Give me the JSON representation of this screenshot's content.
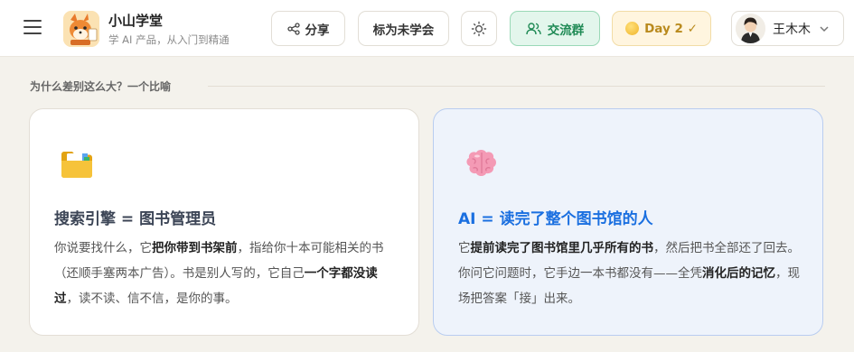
{
  "header": {
    "brand": {
      "name": "小山学堂",
      "subtitle": "学 AI 产品，从入门到精通"
    },
    "share_label": "分享",
    "mark_label": "标为未学会",
    "group_label": "交流群",
    "day_label": "Day 2 ✓",
    "user_name": "王木木",
    "colors": {
      "group_accent": "#1f8a55",
      "day_accent": "#b98a1d"
    }
  },
  "section": {
    "title": "为什么差别这么大？一个比喻"
  },
  "cards": [
    {
      "icon": "folder-icon",
      "title": "搜索引擎 = 图书管理员",
      "body": [
        {
          "text": "你说要找什么，它",
          "bold": false
        },
        {
          "text": "把你带到书架前",
          "bold": true
        },
        {
          "text": "，指给你十本可能相关的书（还顺手塞两本广告）。书是别人写的，它自己",
          "bold": false
        },
        {
          "text": "一个字都没读过",
          "bold": true
        },
        {
          "text": "，读不读、信不信，是你的事。",
          "bold": false
        }
      ]
    },
    {
      "icon": "brain-icon",
      "title": "AI = 读完了整个图书馆的人",
      "body": [
        {
          "text": "它",
          "bold": false
        },
        {
          "text": "提前读完了图书馆里几乎所有的书",
          "bold": true
        },
        {
          "text": "，然后把书全部还了回去。你问它问题时，它手边一本书都没有——全凭",
          "bold": false
        },
        {
          "text": "消化后的记忆",
          "bold": true
        },
        {
          "text": "，现场把答案「接」出来。",
          "bold": false
        }
      ]
    }
  ]
}
